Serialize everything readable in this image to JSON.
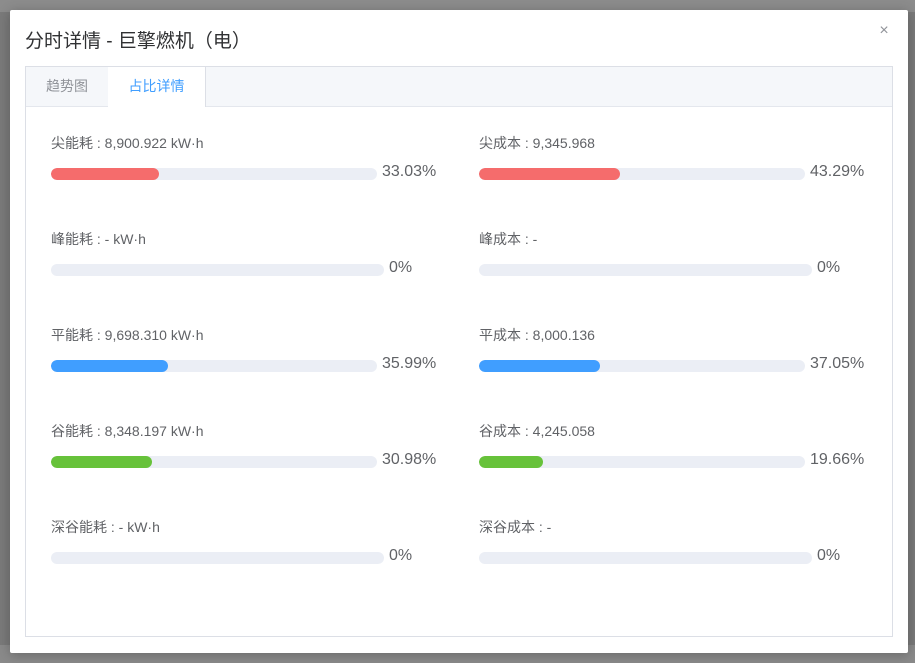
{
  "modal": {
    "title": "分时详情 - 巨擎燃机（电）",
    "close_glyph": "×"
  },
  "tabs": [
    {
      "label": "趋势图",
      "active": false
    },
    {
      "label": "占比详情",
      "active": true
    }
  ],
  "colors": {
    "peak": "#f56c6c",
    "flat": "#409eff",
    "valley": "#67c23a"
  },
  "metrics": {
    "energy": [
      {
        "label": "尖能耗 : 8,900.922 kW·h",
        "percent": "33.03%",
        "value": 33.03,
        "color": "#f56c6c"
      },
      {
        "label": "峰能耗 : - kW·h",
        "percent": "0%",
        "value": 0,
        "color": "#f56c6c"
      },
      {
        "label": "平能耗 : 9,698.310 kW·h",
        "percent": "35.99%",
        "value": 35.99,
        "color": "#409eff"
      },
      {
        "label": "谷能耗 : 8,348.197 kW·h",
        "percent": "30.98%",
        "value": 30.98,
        "color": "#67c23a"
      },
      {
        "label": "深谷能耗 : - kW·h",
        "percent": "0%",
        "value": 0,
        "color": "#67c23a"
      }
    ],
    "cost": [
      {
        "label": "尖成本 : 9,345.968",
        "percent": "43.29%",
        "value": 43.29,
        "color": "#f56c6c"
      },
      {
        "label": "峰成本 : -",
        "percent": "0%",
        "value": 0,
        "color": "#f56c6c"
      },
      {
        "label": "平成本 : 8,000.136",
        "percent": "37.05%",
        "value": 37.05,
        "color": "#409eff"
      },
      {
        "label": "谷成本 : 4,245.058",
        "percent": "19.66%",
        "value": 19.66,
        "color": "#67c23a"
      },
      {
        "label": "深谷成本 : -",
        "percent": "0%",
        "value": 0,
        "color": "#67c23a"
      }
    ]
  }
}
